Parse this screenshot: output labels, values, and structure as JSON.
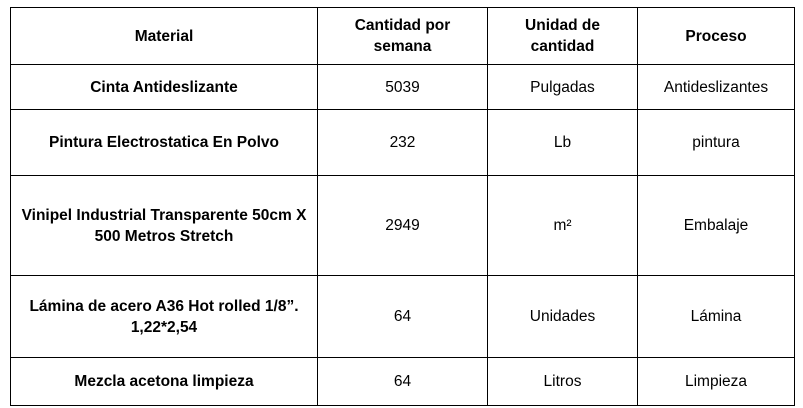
{
  "table": {
    "headers": {
      "material": "Material",
      "cantidad": "Cantidad por semana",
      "unidad": "Unidad de cantidad",
      "proceso": "Proceso"
    },
    "rows": [
      {
        "material": "Cinta Antideslizante",
        "cantidad": "5039",
        "unidad": "Pulgadas",
        "proceso": "Antideslizantes"
      },
      {
        "material": "Pintura Electrostatica En Polvo",
        "cantidad": "232",
        "unidad": "Lb",
        "proceso": "pintura"
      },
      {
        "material": "Vinipel Industrial Transparente 50cm X 500 Metros Stretch",
        "cantidad": "2949",
        "unidad": "m²",
        "proceso": "Embalaje"
      },
      {
        "material": "Lámina de acero A36 Hot rolled 1/8”. 1,22*2,54",
        "cantidad": "64",
        "unidad": "Unidades",
        "proceso": "Lámina"
      },
      {
        "material": "Mezcla acetona limpieza",
        "cantidad": "64",
        "unidad": "Litros",
        "proceso": "Limpieza"
      }
    ]
  }
}
